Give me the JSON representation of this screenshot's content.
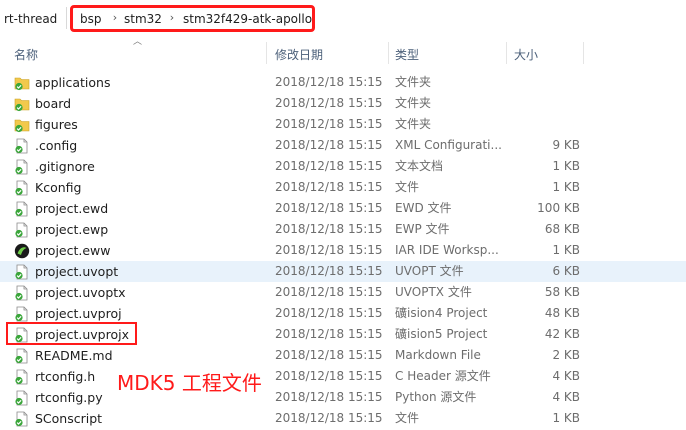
{
  "breadcrumb": {
    "items": [
      "rt-thread",
      "bsp",
      "stm32",
      "stm32f429-atk-apollo"
    ],
    "separator": "›"
  },
  "columns": {
    "name": "名称",
    "date": "修改日期",
    "type": "类型",
    "size": "大小"
  },
  "files": [
    {
      "name": "applications",
      "date": "2018/12/18 15:15",
      "type": "文件夹",
      "size": "",
      "icon": "folder-icon"
    },
    {
      "name": "board",
      "date": "2018/12/18 15:15",
      "type": "文件夹",
      "size": "",
      "icon": "folder-icon"
    },
    {
      "name": "figures",
      "date": "2018/12/18 15:15",
      "type": "文件夹",
      "size": "",
      "icon": "folder-icon"
    },
    {
      "name": ".config",
      "date": "2018/12/18 15:15",
      "type": "XML Configurati...",
      "size": "9 KB",
      "icon": "file-icon"
    },
    {
      "name": ".gitignore",
      "date": "2018/12/18 15:15",
      "type": "文本文档",
      "size": "1 KB",
      "icon": "file-icon"
    },
    {
      "name": "Kconfig",
      "date": "2018/12/18 15:15",
      "type": "文件",
      "size": "1 KB",
      "icon": "file-icon"
    },
    {
      "name": "project.ewd",
      "date": "2018/12/18 15:15",
      "type": "EWD 文件",
      "size": "100 KB",
      "icon": "file-icon"
    },
    {
      "name": "project.ewp",
      "date": "2018/12/18 15:15",
      "type": "EWP 文件",
      "size": "68 KB",
      "icon": "file-icon"
    },
    {
      "name": "project.eww",
      "date": "2018/12/18 15:15",
      "type": "IAR IDE Worksp...",
      "size": "1 KB",
      "icon": "iar-workspace-icon"
    },
    {
      "name": "project.uvopt",
      "date": "2018/12/18 15:15",
      "type": "UVOPT 文件",
      "size": "6 KB",
      "icon": "file-icon",
      "selected": true
    },
    {
      "name": "project.uvoptx",
      "date": "2018/12/18 15:15",
      "type": "UVOPTX 文件",
      "size": "58 KB",
      "icon": "file-icon"
    },
    {
      "name": "project.uvproj",
      "date": "2018/12/18 15:15",
      "type": "礦ision4 Project",
      "size": "48 KB",
      "icon": "file-icon"
    },
    {
      "name": "project.uvprojx",
      "date": "2018/12/18 15:15",
      "type": "礦ision5 Project",
      "size": "42 KB",
      "icon": "file-icon"
    },
    {
      "name": "README.md",
      "date": "2018/12/18 15:15",
      "type": "Markdown File",
      "size": "2 KB",
      "icon": "file-icon"
    },
    {
      "name": "rtconfig.h",
      "date": "2018/12/18 15:15",
      "type": "C Header 源文件",
      "size": "4 KB",
      "icon": "file-icon"
    },
    {
      "name": "rtconfig.py",
      "date": "2018/12/18 15:15",
      "type": "Python 源文件",
      "size": "4 KB",
      "icon": "file-icon"
    },
    {
      "name": "SConscript",
      "date": "2018/12/18 15:15",
      "type": "文件",
      "size": "1 KB",
      "icon": "file-icon"
    }
  ],
  "annotation": "MDK5 工程文件",
  "colors": {
    "highlight": "#ff1a1a",
    "header_text": "#4c607a",
    "selected_row": "#e8f2fb",
    "folder": "#f2c94c",
    "check_overlay": "#3aa63a"
  }
}
